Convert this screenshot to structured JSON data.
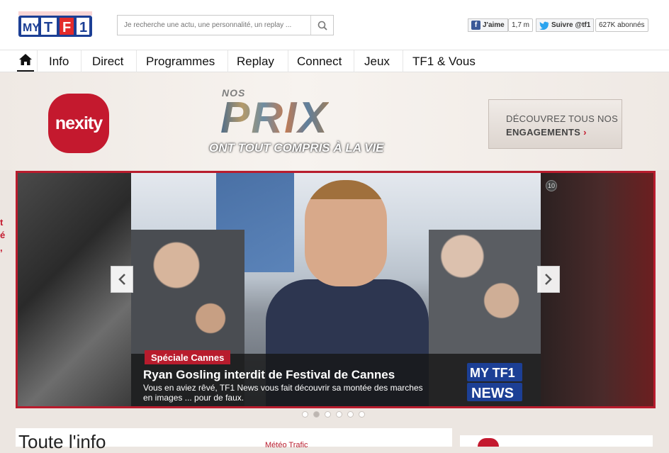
{
  "header": {
    "logo": "MY TF1",
    "search_placeholder": "Je recherche une actu, une personnalité, un replay ...",
    "facebook_like": "J'aime",
    "facebook_count": "1,7 m",
    "twitter_follow": "Suivre @tf1",
    "twitter_count": "627K abonnés"
  },
  "nav": {
    "items": [
      "Info",
      "Direct",
      "Programmes",
      "Replay",
      "Connect",
      "Jeux",
      "TF1 & Vous"
    ]
  },
  "banner": {
    "advertiser": "nexity",
    "prix_small": "NOS",
    "prix_big": "PRIX",
    "prix_sub": "ONT TOUT COMPRIS À LA VIE",
    "cta_line1": "DÉCOUVREZ TOUS NOS",
    "cta_line2": "ENGAGEMENTS"
  },
  "slider": {
    "tag": "Spéciale Cannes",
    "headline": "Ryan Gosling interdit de Festival de Cannes",
    "description": "Vous en aviez rêvé, TF1 News vous fait découvrir sa montée des marches en images ... pour de faux.",
    "badge": "10",
    "news_logo_top": "MY TF1",
    "news_logo_bottom": "NEWS",
    "dots": 6,
    "active_dot": 1
  },
  "bottom": {
    "title": "Toute l'info",
    "links": "Météo  Trafic"
  },
  "colors": {
    "brand_red": "#b81c2d",
    "nexity_red": "#c4192e",
    "tf1_blue": "#1c3f95"
  }
}
